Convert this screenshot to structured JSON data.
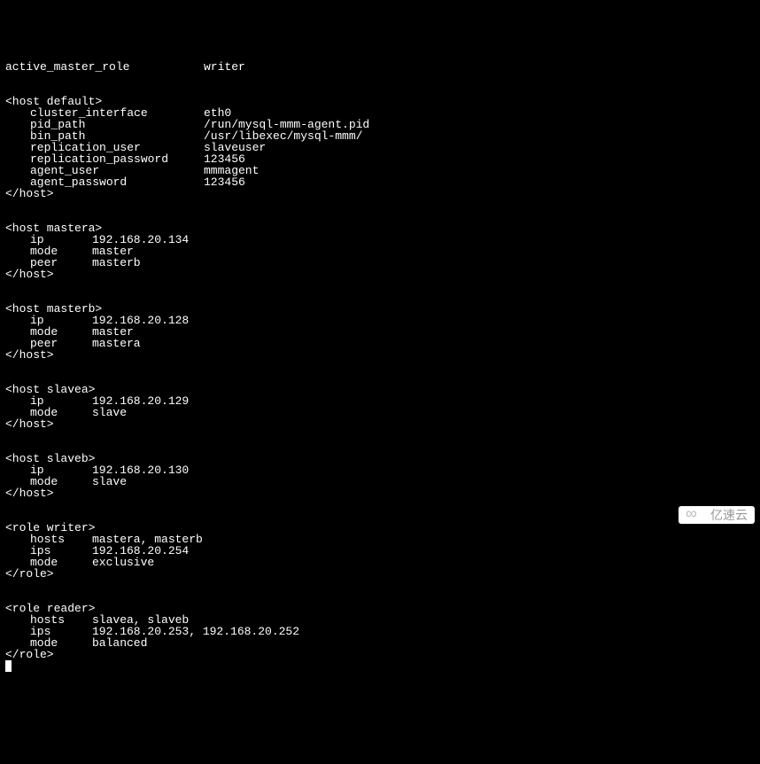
{
  "top": {
    "active_master_role_key": "active_master_role",
    "active_master_role_val": "writer"
  },
  "host_default": {
    "open": "<host default>",
    "close": "</host>",
    "cluster_interface_key": "cluster_interface",
    "cluster_interface_val": "eth0",
    "pid_path_key": "pid_path",
    "pid_path_val": "/run/mysql-mmm-agent.pid",
    "bin_path_key": "bin_path",
    "bin_path_val": "/usr/libexec/mysql-mmm/",
    "replication_user_key": "replication_user",
    "replication_user_val": "slaveuser",
    "replication_password_key": "replication_password",
    "replication_password_val": "123456",
    "agent_user_key": "agent_user",
    "agent_user_val": "mmmagent",
    "agent_password_key": "agent_password",
    "agent_password_val": "123456"
  },
  "host_mastera": {
    "open": "<host mastera>",
    "close": "</host>",
    "ip_key": "ip",
    "ip_val": "192.168.20.134",
    "mode_key": "mode",
    "mode_val": "master",
    "peer_key": "peer",
    "peer_val": "masterb"
  },
  "host_masterb": {
    "open": "<host masterb>",
    "close": "</host>",
    "ip_key": "ip",
    "ip_val": "192.168.20.128",
    "mode_key": "mode",
    "mode_val": "master",
    "peer_key": "peer",
    "peer_val": "mastera"
  },
  "host_slavea": {
    "open": "<host slavea>",
    "close": "</host>",
    "ip_key": "ip",
    "ip_val": "192.168.20.129",
    "mode_key": "mode",
    "mode_val": "slave"
  },
  "host_slaveb": {
    "open": "<host slaveb>",
    "close": "</host>",
    "ip_key": "ip",
    "ip_val": "192.168.20.130",
    "mode_key": "mode",
    "mode_val": "slave"
  },
  "role_writer": {
    "open": "<role writer>",
    "close": "</role>",
    "hosts_key": "hosts",
    "hosts_val": "mastera, masterb",
    "ips_key": "ips",
    "ips_val": "192.168.20.254",
    "mode_key": "mode",
    "mode_val": "exclusive"
  },
  "role_reader": {
    "open": "<role reader>",
    "close": "</role>",
    "hosts_key": "hosts",
    "hosts_val": "slavea, slaveb",
    "ips_key": "ips",
    "ips_val": "192.168.20.253, 192.168.20.252",
    "mode_key": "mode",
    "mode_val": "balanced"
  },
  "watermark": {
    "text": "亿速云"
  }
}
